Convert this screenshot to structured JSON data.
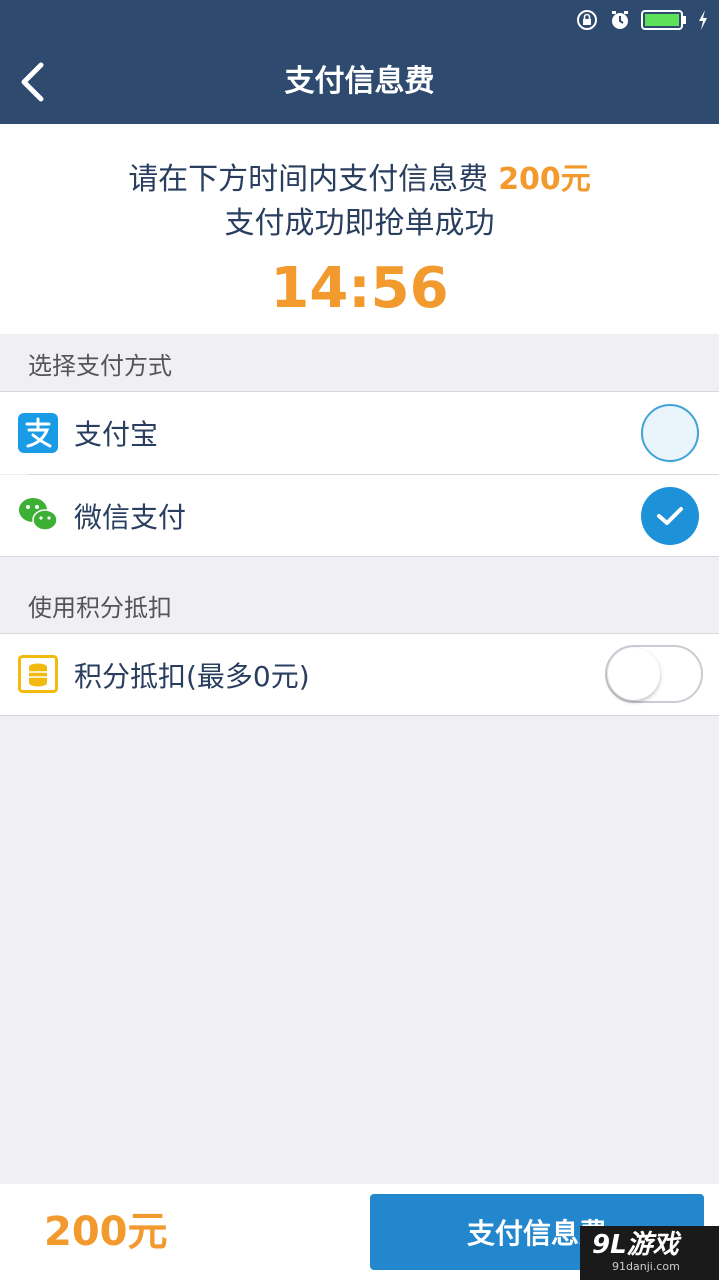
{
  "nav": {
    "title": "支付信息费"
  },
  "notice": {
    "line1_prefix": "请在下方时间内支付信息费",
    "line1_amount": "200元",
    "line2": "支付成功即抢单成功",
    "countdown": "14:56"
  },
  "payment_section": {
    "header": "选择支付方式",
    "methods": [
      {
        "label": "支付宝",
        "icon": "alipay-icon",
        "selected": false
      },
      {
        "label": "微信支付",
        "icon": "wechat-icon",
        "selected": true
      }
    ]
  },
  "points_section": {
    "header": "使用积分抵扣",
    "toggle_label": "积分抵扣(最多0元)",
    "icon": "coins-icon",
    "enabled": false
  },
  "footer": {
    "amount": "200元",
    "pay_button_label": "支付信息费"
  },
  "watermark": {
    "main": "9L游戏",
    "sub": "91danji.com"
  },
  "colors": {
    "header_bg": "#2e4a6e",
    "accent_orange": "#f29a2e",
    "button_blue": "#2287cc",
    "radio_selected": "#1e92d9"
  }
}
